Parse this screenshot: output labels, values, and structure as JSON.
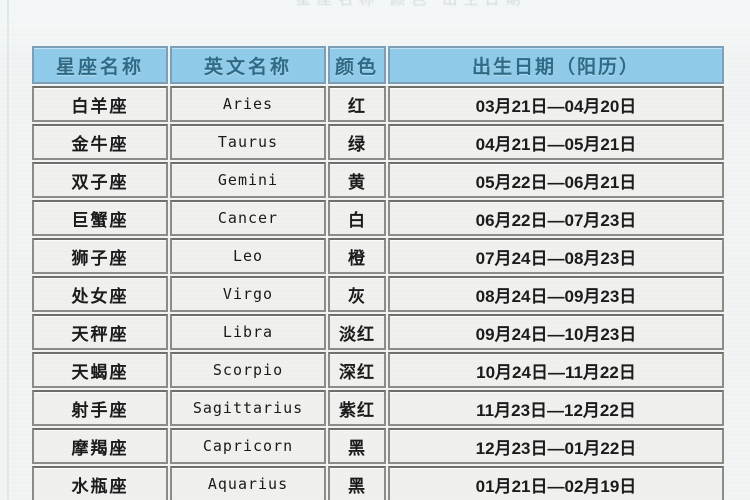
{
  "page": {
    "top_clipped_text": "星座名称  颜色  出生日期",
    "background_color": "#f2f5f5"
  },
  "table": {
    "header_bg_color": "#90cbea",
    "header_text_color": "#2f6a86",
    "cell_bg_color": "#f0f0ee",
    "cell_border_color": "#8c8c86",
    "columns": [
      {
        "key": "name",
        "label": "星座名称"
      },
      {
        "key": "eng",
        "label": "英文名称"
      },
      {
        "key": "color",
        "label": "颜色"
      },
      {
        "key": "date",
        "label": "出生日期（阳历）"
      }
    ],
    "rows": [
      {
        "name": "白羊座",
        "eng": "Aries",
        "color": "红",
        "date": "03月21日—04月20日"
      },
      {
        "name": "金牛座",
        "eng": "Taurus",
        "color": "绿",
        "date": "04月21日—05月21日"
      },
      {
        "name": "双子座",
        "eng": "Gemini",
        "color": "黄",
        "date": "05月22日—06月21日"
      },
      {
        "name": "巨蟹座",
        "eng": "Cancer",
        "color": "白",
        "date": "06月22日—07月23日"
      },
      {
        "name": "狮子座",
        "eng": "Leo",
        "color": "橙",
        "date": "07月24日—08月23日"
      },
      {
        "name": "处女座",
        "eng": "Virgo",
        "color": "灰",
        "date": "08月24日—09月23日"
      },
      {
        "name": "天秤座",
        "eng": "Libra",
        "color": "淡红",
        "date": "09月24日—10月23日"
      },
      {
        "name": "天蝎座",
        "eng": "Scorpio",
        "color": "深红",
        "date": "10月24日—11月22日"
      },
      {
        "name": "射手座",
        "eng": "Sagittarius",
        "color": "紫红",
        "date": "11月23日—12月22日"
      },
      {
        "name": "摩羯座",
        "eng": "Capricorn",
        "color": "黑",
        "date": "12月23日—01月22日"
      },
      {
        "name": "水瓶座",
        "eng": "Aquarius",
        "color": "黑",
        "date": "01月21日—02月19日"
      }
    ]
  }
}
